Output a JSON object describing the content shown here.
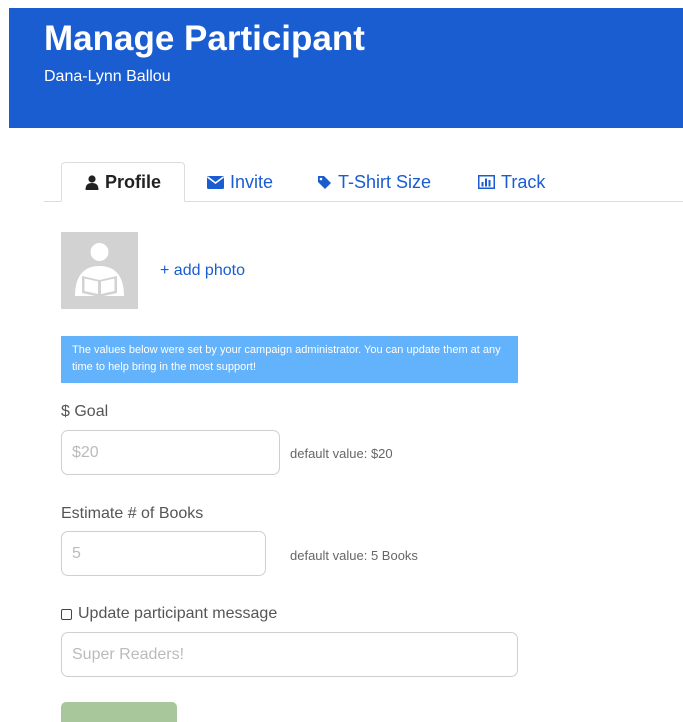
{
  "header": {
    "title": "Manage Participant",
    "participant_name": "Dana-Lynn Ballou",
    "background_color": "#1a5dd0"
  },
  "tabs": [
    {
      "label": "Profile",
      "icon": "user-icon",
      "active": true
    },
    {
      "label": "Invite",
      "icon": "envelope-icon",
      "active": false
    },
    {
      "label": "T-Shirt Size",
      "icon": "tag-icon",
      "active": false
    },
    {
      "label": "Track",
      "icon": "bar-chart-icon",
      "active": false
    }
  ],
  "profile": {
    "add_photo_label": "+ add photo",
    "avatar_icon": "reader-avatar-icon"
  },
  "info_banner": {
    "text": "The values below were set by your campaign administrator. You can update them at any time to help bring in the most support!",
    "background_color": "#63b2fc"
  },
  "goal": {
    "label": "$ Goal",
    "prefix": "$",
    "placeholder": "20",
    "hint": "default value: $20"
  },
  "books": {
    "label": "Estimate # of Books",
    "placeholder": "5",
    "hint": "default value: 5 Books"
  },
  "message": {
    "checkbox_label": "Update participant message",
    "checked": false,
    "placeholder": "Super Readers!"
  },
  "save_button": {
    "color": "#a8c89c"
  }
}
